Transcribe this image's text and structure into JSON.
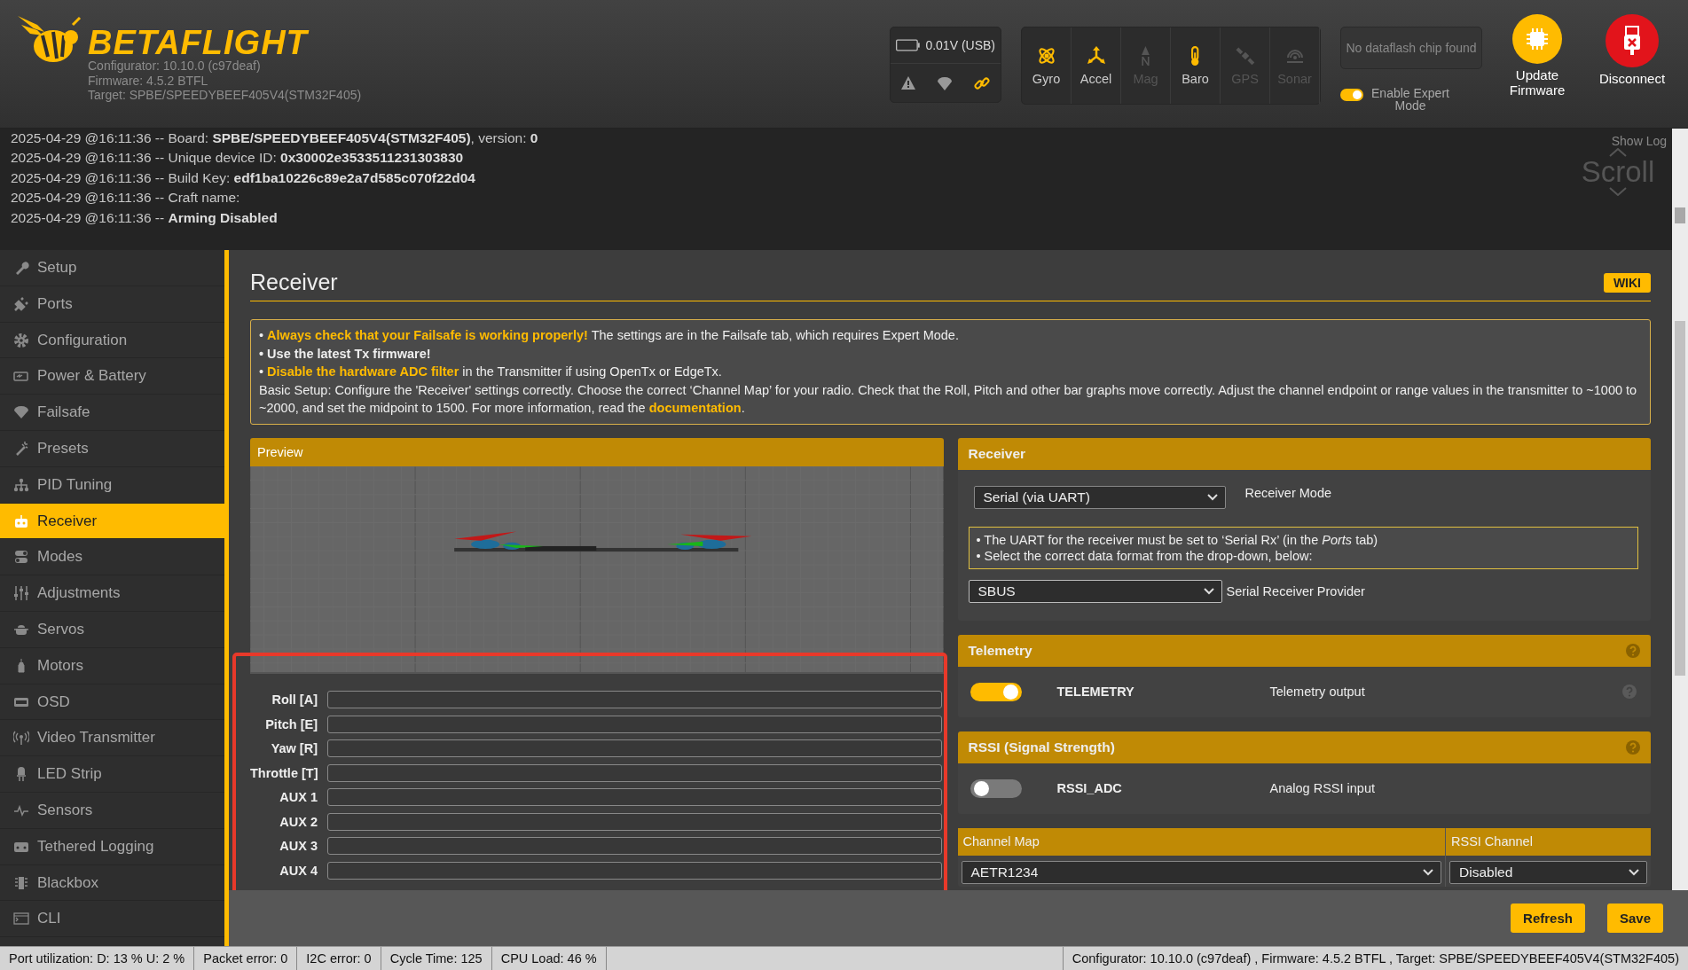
{
  "header": {
    "brand": "BETAFLIGHT",
    "info": [
      "Configurator: 10.10.0 (c97deaf)",
      "Firmware: 4.5.2 BTFL",
      "Target: SPBE/SPEEDYBEEF405V4(STM32F405)"
    ],
    "battery": "0.01V (USB)",
    "sensors": [
      {
        "label": "Gyro",
        "active": true
      },
      {
        "label": "Accel",
        "active": true
      },
      {
        "label": "Mag",
        "active": false
      },
      {
        "label": "Baro",
        "active": true
      },
      {
        "label": "GPS",
        "active": false
      },
      {
        "label": "Sonar",
        "active": false
      }
    ],
    "dataflash": "No dataflash chip found",
    "expert_mode": {
      "label": "Enable Expert Mode",
      "on": true
    },
    "update_button": "Update Firmware",
    "disconnect_button": "Disconnect"
  },
  "log": {
    "lines": [
      "2025-04-29 @16:11:36 -- Board: **SPBE/SPEEDYBEEF405V4(STM32F405)**, version: **0**",
      "2025-04-29 @16:11:36 -- Unique device ID: **0x30002e3533511231303830**",
      "2025-04-29 @16:11:36 -- Build Key: **edf1ba10226c89e2a7d585c070f22d04**",
      "2025-04-29 @16:11:36 -- Craft name:",
      "2025-04-29 @16:11:36 -- **Arming Disabled**"
    ],
    "show_log": "Show Log",
    "scroll": "Scroll"
  },
  "sidebar": {
    "items": [
      {
        "label": "Setup",
        "selected": false
      },
      {
        "label": "Ports",
        "selected": false
      },
      {
        "label": "Configuration",
        "selected": false
      },
      {
        "label": "Power & Battery",
        "selected": false
      },
      {
        "label": "Failsafe",
        "selected": false
      },
      {
        "label": "Presets",
        "selected": false
      },
      {
        "label": "PID Tuning",
        "selected": false
      },
      {
        "label": "Receiver",
        "selected": true
      },
      {
        "label": "Modes",
        "selected": false
      },
      {
        "label": "Adjustments",
        "selected": false
      },
      {
        "label": "Servos",
        "selected": false
      },
      {
        "label": "Motors",
        "selected": false
      },
      {
        "label": "OSD",
        "selected": false
      },
      {
        "label": "Video Transmitter",
        "selected": false
      },
      {
        "label": "LED Strip",
        "selected": false
      },
      {
        "label": "Sensors",
        "selected": false
      },
      {
        "label": "Tethered Logging",
        "selected": false
      },
      {
        "label": "Blackbox",
        "selected": false
      },
      {
        "label": "CLI",
        "selected": false
      }
    ]
  },
  "page": {
    "title": "Receiver",
    "wiki": "WIKI",
    "notice": [
      {
        "kind": "warning",
        "text": "• **Always check that your Failsafe is working properly!** The settings are in the Failsafe tab, which requires Expert Mode."
      },
      {
        "kind": "strong",
        "text": "• Use the latest Tx firmware!"
      },
      {
        "kind": "warning",
        "text": "• **Disable the hardware ADC filter** in the Transmitter if using OpenTx or EdgeTx."
      },
      {
        "kind": "plain",
        "text": "Basic Setup: Configure the 'Receiver' settings correctly. Choose the correct ‘Channel Map’ for your radio. Check that the Roll, Pitch and other bar graphs move correctly. Adjust the channel endpoint or range values in the transmitter to ~1000 to ~2000, and set the midpoint to 1500. For more information, read the",
        "link": "documentation",
        "after": "."
      }
    ],
    "preview": {
      "title": "Preview"
    },
    "channels_highlighted": true,
    "channels": [
      {
        "name": "Roll [A]",
        "level": 0
      },
      {
        "name": "Pitch [E]",
        "level": 0
      },
      {
        "name": "Yaw [R]",
        "level": 0
      },
      {
        "name": "Throttle [T]",
        "level": 0
      },
      {
        "name": "AUX 1",
        "level": 0
      },
      {
        "name": "AUX 2",
        "level": 0
      },
      {
        "name": "AUX 3",
        "level": 0
      },
      {
        "name": "AUX 4",
        "level": 0
      }
    ],
    "receiver": {
      "title": "Receiver",
      "mode": "Serial (via UART)",
      "mode_label": "Receiver Mode",
      "info": [
        "• The UART for the receiver must be set to ‘Serial Rx’ (in the *Ports* tab)",
        "• Select the correct data format from the drop-down, below:"
      ],
      "provider": "SBUS",
      "provider_label": "Serial Receiver Provider"
    },
    "telemetry": {
      "title": "Telemetry",
      "name": "TELEMETRY",
      "on": true,
      "description": "Telemetry output"
    },
    "rssi": {
      "title": "RSSI (Signal Strength)",
      "name": "RSSI_ADC",
      "on": false,
      "description": "Analog RSSI input"
    },
    "channel_map": {
      "title": "Channel Map",
      "value": "AETR1234"
    },
    "rssi_channel": {
      "title": "RSSI Channel",
      "value": "Disabled"
    },
    "buttons": [
      "Refresh",
      "Save"
    ]
  },
  "status_bar": {
    "items": [
      "Port utilization: D: 13 % U: 2 %",
      "Packet error: 0",
      "I2C error: 0",
      "Cycle Time: 125",
      "CPU Load: 46 %"
    ],
    "version": "Configurator: 10.10.0 (c97deaf) , Firmware: 4.5.2 BTFL , Target: SPBE/SPEEDYBEEF405V4(STM32F405)"
  }
}
